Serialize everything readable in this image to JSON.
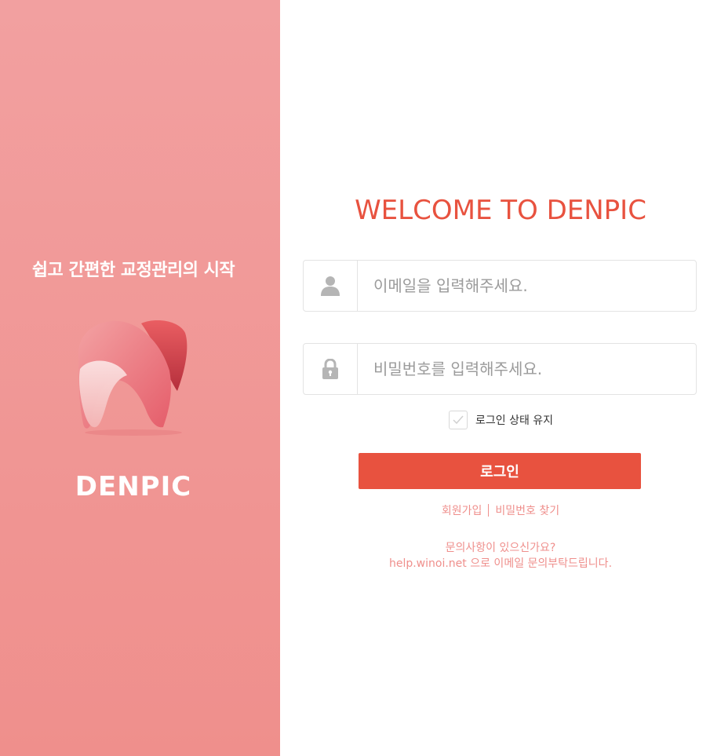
{
  "left_panel": {
    "tagline": "쉽고 간편한 교정관리의 시작",
    "brand": "DENPIC",
    "logo_icon": "tooth-logo-icon"
  },
  "login": {
    "welcome": "WELCOME TO DENPIC",
    "email_placeholder": "이메일을 입력해주세요.",
    "email_value": "",
    "password_placeholder": "비밀번호를 입력해주세요.",
    "password_value": "",
    "keep_login_label": "로그인 상태 유지",
    "keep_login_checked": false,
    "login_button": "로그인",
    "signup_link": "회원가입",
    "find_password_link": "비밀번호 찾기",
    "inquiry_line1": "문의사항이 있으신가요?",
    "inquiry_line2": "help.winoi.net 으로 이메일 문의부탁드립니다."
  },
  "icons": {
    "user": "user-icon",
    "lock": "lock-icon",
    "check": "check-icon"
  },
  "colors": {
    "accent": "#e8523f",
    "left_panel": "#f09b9a",
    "link": "#ef8f8c"
  }
}
